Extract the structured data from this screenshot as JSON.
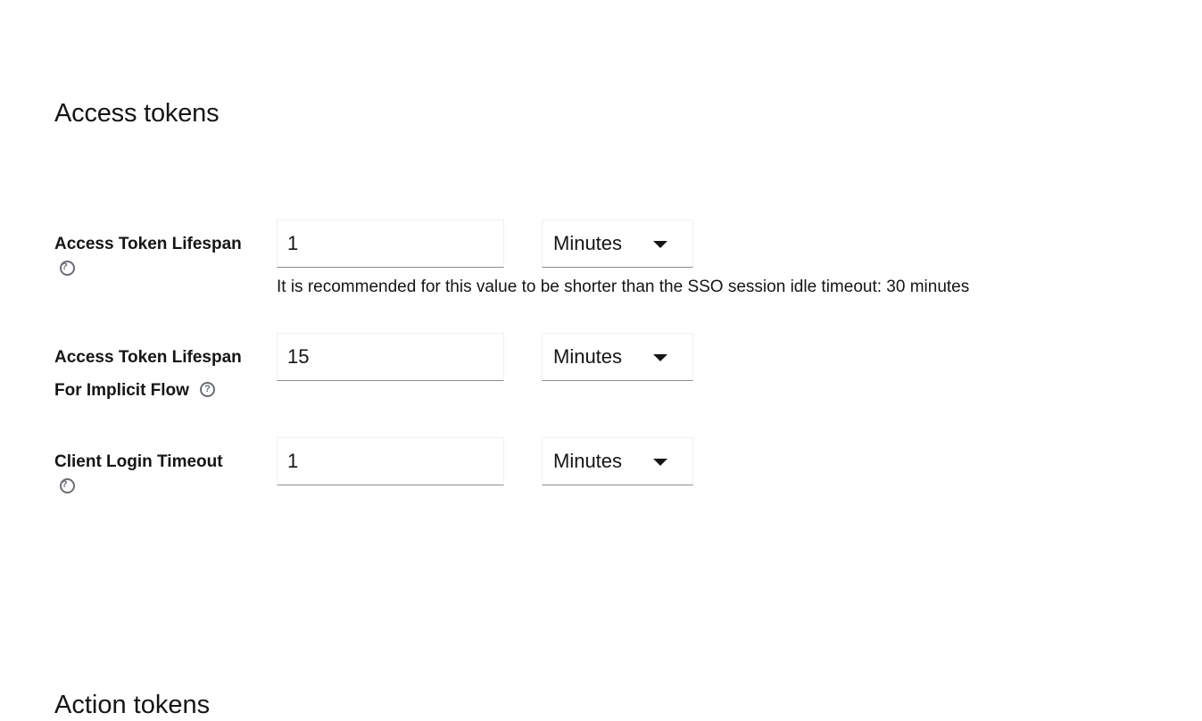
{
  "section": {
    "title": "Access tokens"
  },
  "fields": [
    {
      "label": "Access Token Lifespan",
      "value": "1",
      "unit": "Minutes",
      "help_icon": "question-circle-icon"
    },
    {
      "label_line1": "Access Token Lifespan",
      "label_line2": "For Implicit Flow",
      "value": "15",
      "unit": "Minutes",
      "help_icon": "question-circle-icon"
    },
    {
      "label": "Client Login Timeout",
      "value": "1",
      "unit": "Minutes",
      "help_icon": "question-circle-icon"
    }
  ],
  "helper_text": "It is recommended for this value to be shorter than the SSO session idle timeout: 30 minutes",
  "next_section": {
    "title": "Action tokens"
  },
  "icons": {
    "help": "?"
  }
}
